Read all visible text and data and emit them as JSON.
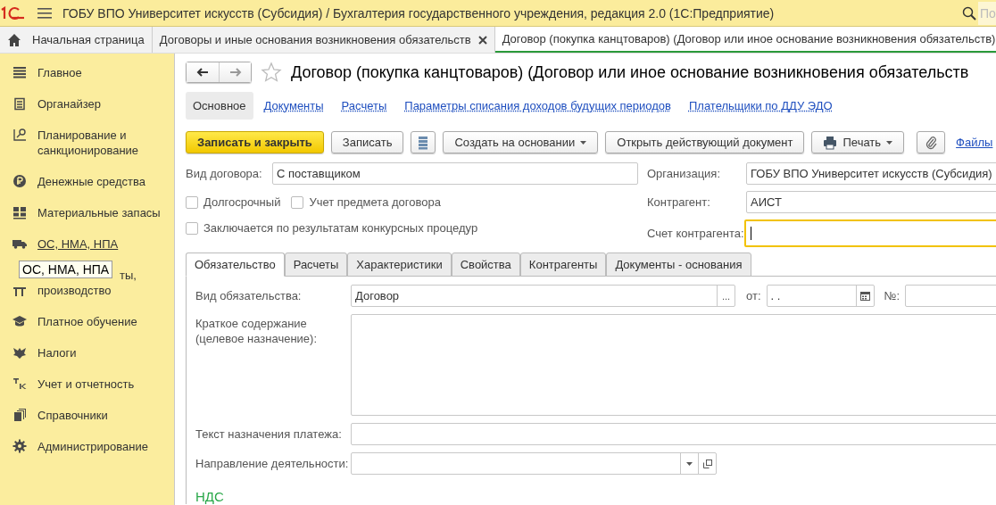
{
  "app_bar": {
    "title": "ГОБУ ВПО Университет искусств (Субсидия) / Бухгалтерия государственного учреждения, редакция 2.0  (1С:Предприятие)",
    "search": {
      "placeholder": "По"
    }
  },
  "window_tabs": [
    {
      "label": "Начальная страница",
      "kind": "home",
      "selected": false
    },
    {
      "label": "Договоры и иные основания возникновения обязательств",
      "kind": "closable",
      "selected": false
    },
    {
      "label": "Договор (покупка канцтоваров) (Договор или иное основание возникновения обязательств)",
      "kind": "plain",
      "selected": true
    }
  ],
  "sidebar": {
    "items": [
      {
        "label_lines": [
          "Главное"
        ],
        "hovered": false
      },
      {
        "label_lines": [
          "Органайзер"
        ],
        "hovered": false
      },
      {
        "label_lines": [
          "Планирование и",
          "санкционирование"
        ],
        "hovered": false
      },
      {
        "label_lines": [
          "Денежные средства"
        ],
        "hovered": false
      },
      {
        "label_lines": [
          "Материальные запасы"
        ],
        "hovered": false
      },
      {
        "label_lines": [
          "ОС, НМА, НПА"
        ],
        "hovered": true
      },
      {
        "label_lines": [
          "ты,",
          "производство"
        ],
        "hovered": false
      },
      {
        "label_lines": [
          "Платное обучение"
        ],
        "hovered": false
      },
      {
        "label_lines": [
          "Налоги"
        ],
        "hovered": false
      },
      {
        "label_lines": [
          "Учет и отчетность"
        ],
        "hovered": false
      },
      {
        "label_lines": [
          "Справочники"
        ],
        "hovered": false
      },
      {
        "label_lines": [
          "Администрирование"
        ],
        "hovered": false
      }
    ],
    "tooltip": "ОС, НМА, НПА"
  },
  "form": {
    "title": "Договор (покупка канцтоваров) (Договор или иное основание возникновения обязательств",
    "sections": [
      {
        "label": "Основное",
        "selected": true
      },
      {
        "label": "Документы",
        "selected": false
      },
      {
        "label": "Расчеты",
        "selected": false
      },
      {
        "label": "Параметры списания доходов будущих периодов",
        "selected": false
      },
      {
        "label": "Плательщики по ДДУ ЭДО",
        "selected": false
      }
    ],
    "toolbar": [
      {
        "label": "Записать и закрыть",
        "kind": "primary"
      },
      {
        "label": "Записать",
        "kind": "plain"
      },
      {
        "kind": "list"
      },
      {
        "label": "Создать на основании",
        "kind": "dropdown"
      },
      {
        "label": "Открыть действующий документ",
        "kind": "plain"
      },
      {
        "label": "Печать",
        "kind": "print"
      },
      {
        "kind": "clip"
      },
      {
        "label": "Файлы",
        "kind": "link"
      }
    ],
    "contract_type": {
      "label": "Вид договора:",
      "value": "С поставщиком"
    },
    "checkboxes": [
      {
        "label": "Долгосрочный",
        "checked": false
      },
      {
        "label": "Учет предмета договора",
        "checked": false
      },
      {
        "label": "Заключается по результатам конкурсных процедур",
        "checked": false
      }
    ],
    "organization": {
      "label": "Организация:",
      "value": "ГОБУ ВПО Университет искусств (Субсидия)"
    },
    "counterparty": {
      "label": "Контрагент:",
      "value": "АИСТ"
    },
    "counterparty_account": {
      "label": "Счет контрагента:",
      "focused": true
    },
    "tabs": [
      {
        "label": "Обязательство",
        "selected": true
      },
      {
        "label": "Расчеты",
        "selected": false
      },
      {
        "label": "Характеристики",
        "selected": false
      },
      {
        "label": "Свойства",
        "selected": false
      },
      {
        "label": "Контрагенты",
        "selected": false
      },
      {
        "label": "Документы - основания",
        "selected": false
      }
    ],
    "obligation": {
      "type_label": "Вид обязательства:",
      "type_value": "Договор",
      "type_button": "...",
      "date_label": "от:",
      "date_value": " .  .",
      "number_label": "№:",
      "summary_label": "Краткое содержание (целевое назначение):",
      "payment_text_label": "Текст назначения платежа:",
      "activity_label": "Направление деятельности:"
    },
    "vat_heading": "НДС"
  }
}
